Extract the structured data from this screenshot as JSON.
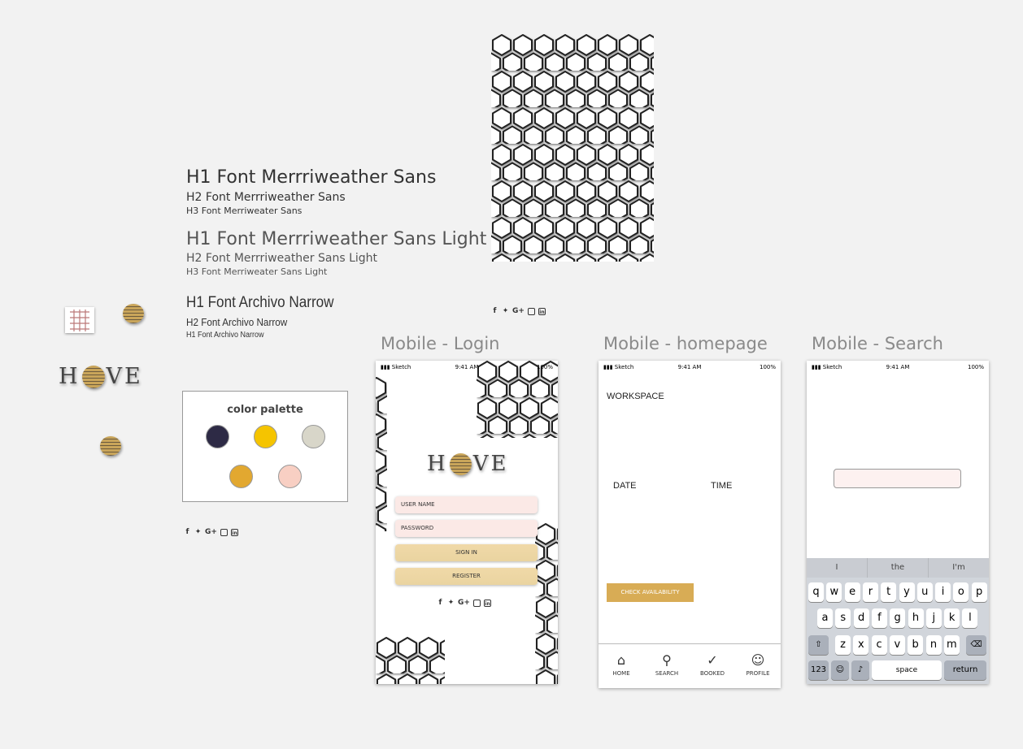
{
  "typography": {
    "merri_h1": "H1 Font Merrriweather Sans",
    "merri_h2": "H2 Font Merrriweather Sans",
    "merri_h3": "H3 Font Merriweater Sans",
    "light_h1": "H1 Font Merrriweather Sans Light",
    "light_h2": "H2 Font Merrriweather Sans Light",
    "light_h3": "H3 Font Merriweater Sans Light",
    "narrow_h1": "H1 Font Archivo Narrow",
    "narrow_h2": "H2 Font Archivo Narrow",
    "narrow_h3": "H1 Font Archivo Narrow"
  },
  "logo": {
    "left": "H",
    "right": "VE"
  },
  "social": {
    "facebook": "f",
    "twitter": "🐦",
    "google": "G+",
    "instagram": "◙",
    "linkedin": "in"
  },
  "palette": {
    "title": "color palette",
    "colors": [
      "#2d2a45",
      "#f5c400",
      "#d8d6c9",
      "#e2a830",
      "#f8cfc3"
    ]
  },
  "frames": {
    "login_title": "Mobile - Login",
    "home_title": "Mobile - homepage",
    "search_title": "Mobile - Search"
  },
  "status": {
    "carrier": "Sketch",
    "time": "9:41 AM",
    "battery": "100%"
  },
  "login": {
    "username_label": "USER NAME",
    "password_label": "PASSWORD",
    "signin_label": "SIGN IN",
    "register_label": "REGISTER"
  },
  "home": {
    "workspace_label": "WORKSPACE",
    "date_label": "DATE",
    "time_label": "TIME",
    "check_label": "CHECK AVAILABILITY",
    "nav": [
      "HOME",
      "SEARCH",
      "BOOKED",
      "PROFILE"
    ]
  },
  "search": {
    "suggestions": [
      "I",
      "the",
      "I'm"
    ],
    "row1": [
      "q",
      "w",
      "e",
      "r",
      "t",
      "y",
      "u",
      "i",
      "o",
      "p"
    ],
    "row2": [
      "a",
      "s",
      "d",
      "f",
      "g",
      "h",
      "j",
      "k",
      "l"
    ],
    "row3": [
      "z",
      "x",
      "c",
      "v",
      "b",
      "n",
      "m"
    ],
    "numbers_key": "123",
    "space_key": "space",
    "return_key": "return"
  }
}
